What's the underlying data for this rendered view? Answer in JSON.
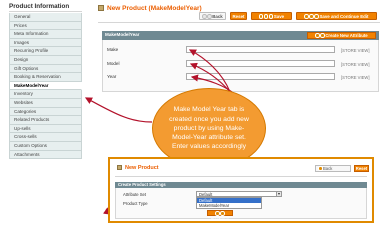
{
  "sidebar": {
    "title": "Product Information",
    "items": [
      {
        "label": "General"
      },
      {
        "label": "Prices"
      },
      {
        "label": "Meta Information"
      },
      {
        "label": "Images"
      },
      {
        "label": "Recurring Profile"
      },
      {
        "label": "Design"
      },
      {
        "label": "Gift Options"
      },
      {
        "label": "Booking & Reservation"
      },
      {
        "label": "MakeModelYear",
        "active": true
      },
      {
        "label": "Inventory"
      },
      {
        "label": "Websites"
      },
      {
        "label": "Categories"
      },
      {
        "label": "Related Products"
      },
      {
        "label": "Up-sells"
      },
      {
        "label": "Cross-sells"
      },
      {
        "label": "Custom Options"
      },
      {
        "label": "Attachments"
      }
    ]
  },
  "header": {
    "title": "New Product (MakeModelYear)",
    "back_label": "Back",
    "reset_label": "Reset",
    "save_label": "Save",
    "save_continue_label": "Save and Continue Edit"
  },
  "fieldset": {
    "title": "MakeModelYear",
    "create_attribute_label": "Create New Attribute",
    "fields": [
      {
        "label": "Make",
        "scope": "[STORE VIEW]"
      },
      {
        "label": "Model",
        "scope": "[STORE VIEW]"
      },
      {
        "label": "Year",
        "scope": "[STORE VIEW]"
      }
    ]
  },
  "callout": {
    "text": "Make Model Year tab is created once you add new product by using Make-Model-Year attribute set. Enter values accordingly"
  },
  "inset": {
    "title": "New Product",
    "back_label": "Back",
    "reset_label": "Reset",
    "section_title": "Create Product Settings",
    "attribute_set_label": "Attribute Set",
    "product_type_label": "Product Type",
    "attribute_set_value": "Default",
    "options": [
      "Default",
      "MakeModelYear"
    ],
    "selected_option": "Default",
    "continue_label": "Continue"
  },
  "colors": {
    "accent": "#f18200",
    "title": "#eb5e00",
    "section_header": "#6f8992",
    "callout": "#f39b31",
    "arrow": "#b3122b",
    "selection": "#3570c9"
  }
}
